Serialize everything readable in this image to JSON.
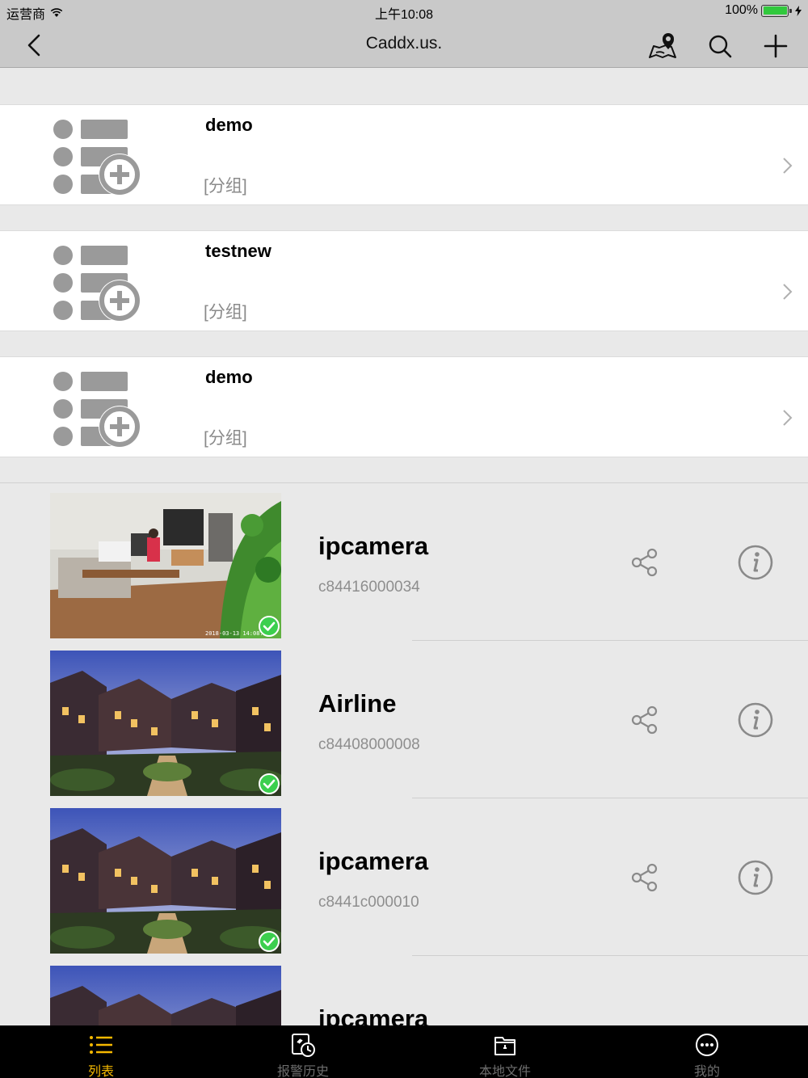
{
  "status_bar": {
    "carrier": "运营商",
    "time": "上午10:08",
    "battery": "100%"
  },
  "nav": {
    "title": "Caddx.us.",
    "back_icon": "chevron-left-icon",
    "actions": [
      "map-pin-icon",
      "search-icon",
      "plus-icon"
    ]
  },
  "groups": [
    {
      "name": "demo",
      "type": "[分组]"
    },
    {
      "name": "testnew",
      "type": "[分组]"
    },
    {
      "name": "demo",
      "type": "[分组]"
    }
  ],
  "cameras": [
    {
      "name": "ipcamera",
      "id": "c84416000034",
      "online": true,
      "thumbnail": "office-scene",
      "timestamp": "2018-03-13 14:08:43"
    },
    {
      "name": "Airline",
      "id": "c84408000008",
      "online": true,
      "thumbnail": "mansion-night"
    },
    {
      "name": "ipcamera",
      "id": "c8441c000010",
      "online": true,
      "thumbnail": "mansion-night"
    },
    {
      "name": "ipcamera",
      "id": "",
      "online": true,
      "thumbnail": "mansion-night"
    }
  ],
  "tabs": [
    {
      "label": "列表",
      "icon": "list-icon",
      "active": true
    },
    {
      "label": "报警历史",
      "icon": "alarm-history-icon",
      "active": false
    },
    {
      "label": "本地文件",
      "icon": "folder-icon",
      "active": false
    },
    {
      "label": "我的",
      "icon": "more-icon",
      "active": false
    }
  ],
  "colors": {
    "accent": "#f5b800",
    "nav_bg": "#c9c9c9",
    "online": "#3ccf4e",
    "tab_bg": "#000000"
  }
}
